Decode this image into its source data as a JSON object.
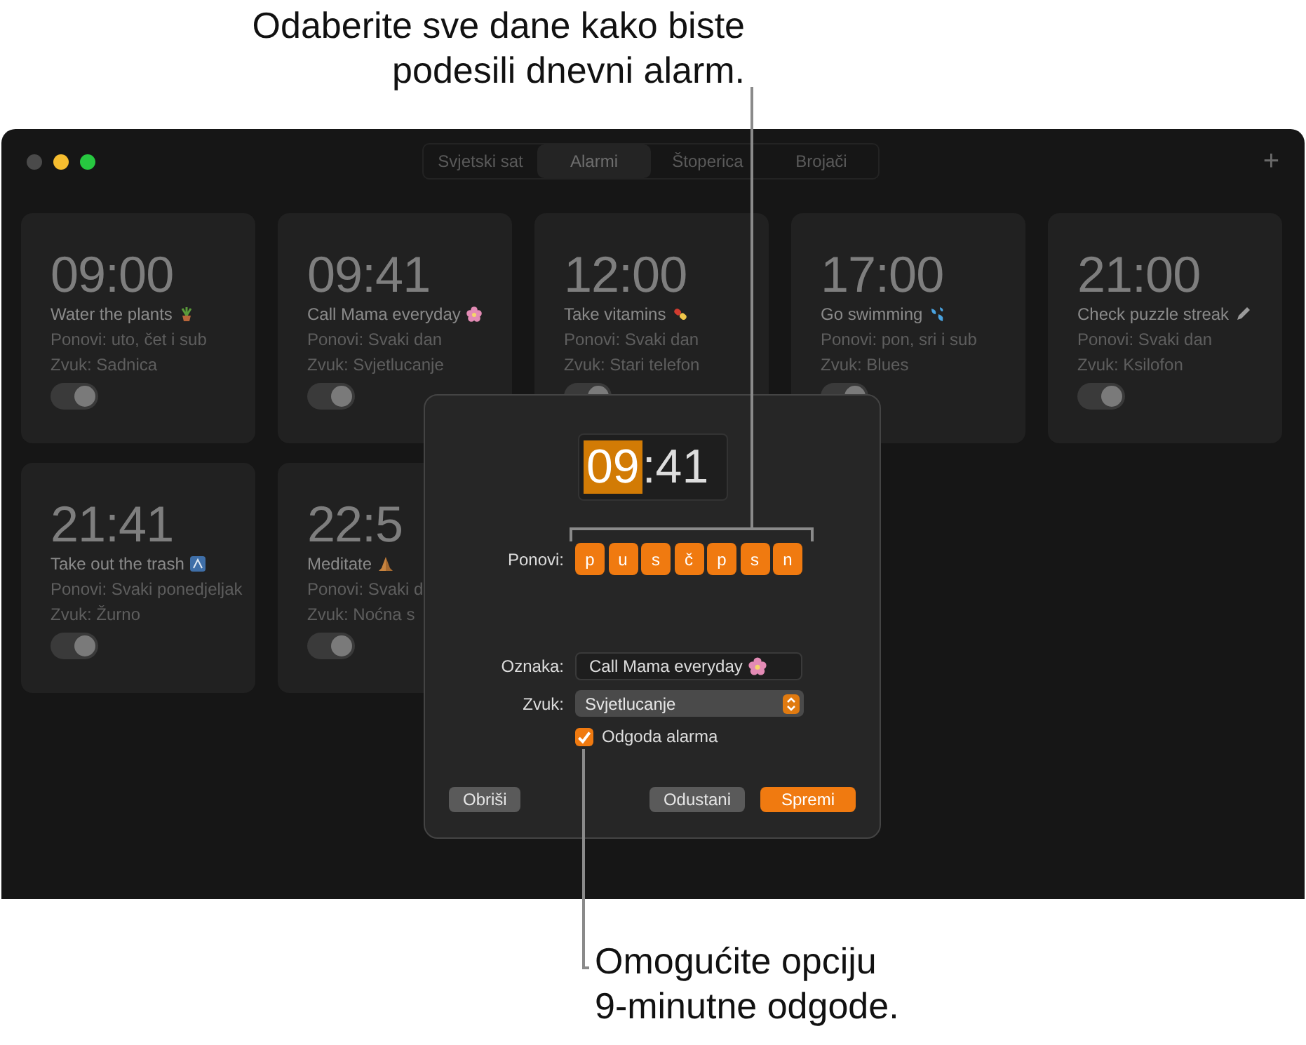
{
  "callouts": [
    {
      "lines": [
        "Odaberite sve dane kako biste",
        "podesili dnevni alarm."
      ]
    },
    {
      "lines": [
        "Omogućite opciju",
        "9-minutne odgode."
      ]
    }
  ],
  "window": {
    "tabs": [
      {
        "label": "Svjetski sat",
        "selected": false
      },
      {
        "label": "Alarmi",
        "selected": true
      },
      {
        "label": "Štoperica",
        "selected": false
      },
      {
        "label": "Brojači",
        "selected": false
      }
    ],
    "add_button": "+",
    "alarms": [
      {
        "time": "09:00",
        "title": "Water the plants",
        "repeat": "Ponovi: uto, čet i sub",
        "sound": "Zvuk: Sadnica",
        "on": true
      },
      {
        "time": "09:41",
        "title": "Call Mama everyday",
        "repeat": "Ponovi: Svaki dan",
        "sound": "Zvuk: Svjetlucanje",
        "on": true
      },
      {
        "time": "12:00",
        "title": "Take vitamins",
        "repeat": "Ponovi: Svaki dan",
        "sound": "Zvuk: Stari telefon",
        "on": true
      },
      {
        "time": "17:00",
        "title": "Go swimming",
        "repeat": "Ponovi: pon, sri i sub",
        "sound": "Zvuk: Blues",
        "on": true
      },
      {
        "time": "21:00",
        "title": "Check puzzle streak",
        "repeat": "Ponovi: Svaki dan",
        "sound": "Zvuk: Ksilofon",
        "on": true
      },
      {
        "time": "21:41",
        "title": "Take out the trash",
        "repeat": "Ponovi: Svaki ponedjeljak",
        "sound": "Zvuk: Žurno",
        "on": true
      },
      {
        "time": "22:5",
        "title": "Meditate",
        "repeat": "Ponovi: Svaki d",
        "sound": "Zvuk: Noćna s",
        "on": true
      }
    ]
  },
  "dialog": {
    "hours": "09",
    "separator": ":",
    "minutes": "41",
    "repeat_label": "Ponovi:",
    "days": [
      {
        "label": "p",
        "selected": true
      },
      {
        "label": "u",
        "selected": true
      },
      {
        "label": "s",
        "selected": true
      },
      {
        "label": "č",
        "selected": true
      },
      {
        "label": "p",
        "selected": true
      },
      {
        "label": "s",
        "selected": true
      },
      {
        "label": "n",
        "selected": true
      }
    ],
    "label_label": "Oznaka:",
    "label_value": "Call Mama everyday",
    "sound_label": "Zvuk:",
    "sound_value": "Svjetlucanje",
    "snooze": {
      "label": "Odgoda alarma",
      "checked": true
    },
    "buttons": {
      "delete": "Obriši",
      "cancel": "Odustani",
      "save": "Spremi"
    }
  }
}
